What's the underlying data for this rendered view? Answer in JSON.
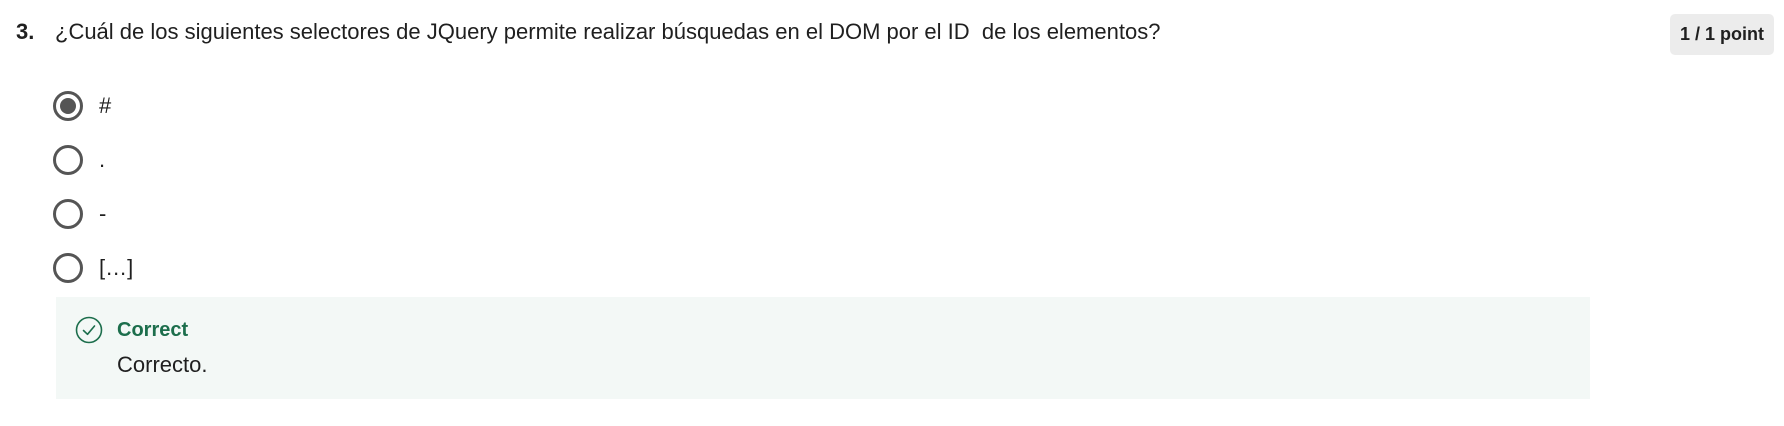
{
  "question": {
    "number": "3.",
    "text": "¿Cuál de los siguientes selectores de JQuery permite realizar búsquedas en el DOM por el ID  de los elementos?",
    "points": "1 / 1 point"
  },
  "options": [
    {
      "label": "#",
      "selected": true
    },
    {
      "label": ".",
      "selected": false
    },
    {
      "label": "-",
      "selected": false
    },
    {
      "label": "[…]",
      "selected": false
    }
  ],
  "feedback": {
    "status": "Correct",
    "message": "Correcto.",
    "icon": "check-circle-icon"
  },
  "colors": {
    "correct_accent": "#1c6e4c",
    "feedback_bg": "#f3f8f6",
    "radio_border": "#555555",
    "badge_bg": "#ececec"
  }
}
